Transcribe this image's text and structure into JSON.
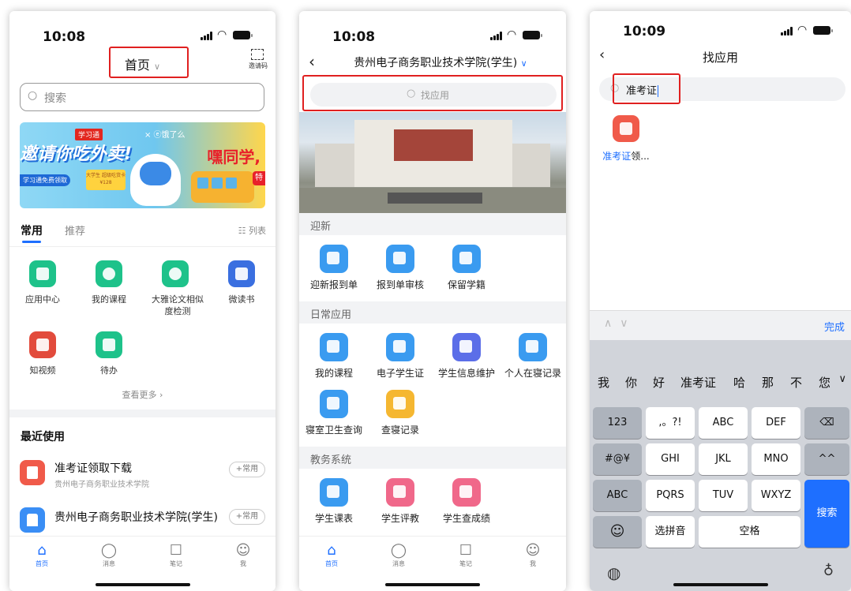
{
  "status_times": [
    "10:08",
    "10:08",
    "10:09"
  ],
  "screen1": {
    "title": "首页",
    "scan_label": "邀请码",
    "search_placeholder": "搜索",
    "banner": {
      "brand": "学习通",
      "brand2": "× ⓔ饿了么",
      "headline": "邀请你吃外卖!",
      "greeting": "嘿同学,",
      "pill": "学习通免费领取",
      "card": "大学生 超级吃货卡 ¥128",
      "corner": "特"
    },
    "tabs": [
      "常用",
      "推荐"
    ],
    "list_mode": "列表",
    "apps": [
      {
        "label": "应用中心",
        "color": "#1ec28a"
      },
      {
        "label": "我的课程",
        "color": "#1ec28a"
      },
      {
        "label": "大雅论文相似度检测",
        "color": "#1ec28a"
      },
      {
        "label": "微读书",
        "color": "#3a6fe0"
      },
      {
        "label": "知视频",
        "color": "#e24b3c"
      },
      {
        "label": "待办",
        "color": "#1ec28a"
      }
    ],
    "more": "查看更多 ›",
    "recent_title": "最近使用",
    "recent": [
      {
        "title": "准考证领取下载",
        "subtitle": "贵州电子商务职业技术学院",
        "button": "+常用",
        "color": "#f05a4a"
      },
      {
        "title": "贵州电子商务职业技术学院(学生)",
        "subtitle": "",
        "button": "+常用",
        "color": "#3a8ef5"
      }
    ]
  },
  "screen2": {
    "title": "贵州电子商务职业技术学院(学生)",
    "search_placeholder": "找应用",
    "sections": [
      {
        "title": "迎新",
        "apps": [
          {
            "label": "迎新报到单",
            "color": "#3a9bf0"
          },
          {
            "label": "报到单审核",
            "color": "#3a9bf0"
          },
          {
            "label": "保留学籍",
            "color": "#3a9bf0"
          }
        ]
      },
      {
        "title": "日常应用",
        "apps": [
          {
            "label": "我的课程",
            "color": "#3a9bf0"
          },
          {
            "label": "电子学生证",
            "color": "#3a9bf0"
          },
          {
            "label": "学生信息维护",
            "color": "#5b6ee8"
          },
          {
            "label": "个人在寝记录",
            "color": "#3a9bf0"
          },
          {
            "label": "寝室卫生查询",
            "color": "#3a9bf0"
          },
          {
            "label": "查寝记录",
            "color": "#f5b731"
          }
        ]
      },
      {
        "title": "教务系统",
        "apps": [
          {
            "label": "学生课表",
            "color": "#3a9bf0"
          },
          {
            "label": "学生评教",
            "color": "#f0688a"
          },
          {
            "label": "学生查成绩",
            "color": "#f0688a"
          }
        ]
      }
    ]
  },
  "screen3": {
    "title": "找应用",
    "search_value": "准考证",
    "result": {
      "highlight": "准考证",
      "rest": "领...",
      "color": "#f05a4a"
    },
    "toolbar_done": "完成",
    "candidates": [
      "我",
      "你",
      "好",
      "准考证",
      "哈",
      "那",
      "不",
      "您"
    ],
    "keys": {
      "row1": [
        "123",
        ",。?!",
        "ABC",
        "DEF"
      ],
      "row2": [
        "#@¥",
        "GHI",
        "JKL",
        "MNO",
        "^^"
      ],
      "row3": [
        "ABC",
        "PQRS",
        "TUV",
        "WXYZ"
      ],
      "pinyin": "选拼音",
      "space": "空格",
      "search": "搜索",
      "backspace_icon": "⌫",
      "emoji_icon": "☺"
    }
  },
  "tabbar": [
    "首页",
    "消息",
    "笔记",
    "我"
  ],
  "highlight_color": "#e02020",
  "accent_color": "#1e6fff"
}
